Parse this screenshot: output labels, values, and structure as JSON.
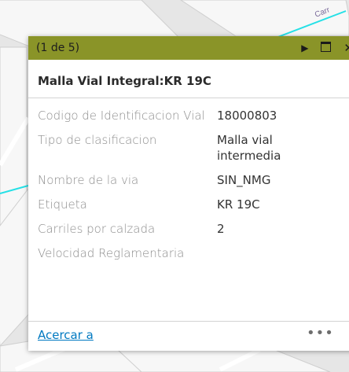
{
  "map": {
    "street_label": "Carr",
    "colors": {
      "background": "#e8e8e8",
      "block": "#f6f6f6",
      "road_highlight": "#25e0e6"
    }
  },
  "popup": {
    "header": {
      "counter": "(1 de 5)",
      "next_icon": "triangle-right-icon",
      "maximize_icon": "maximize-icon",
      "close_icon": "close-icon",
      "color": "#8a9428"
    },
    "title": "Malla Vial Integral:KR 19C",
    "attributes": [
      {
        "key": "Codigo de Identificacion Vial",
        "value": "18000803"
      },
      {
        "key": "Tipo de clasificacion",
        "value": "Malla vial intermedia"
      },
      {
        "key": "Nombre de la via",
        "value": "SIN_NMG"
      },
      {
        "key": "Etiqueta",
        "value": "KR 19C"
      },
      {
        "key": "Carriles por calzada",
        "value": "2"
      },
      {
        "key": "Velocidad Reglamentaria",
        "value": ""
      }
    ],
    "footer": {
      "zoom_link": "Acercar a",
      "more_glyph": "•••",
      "link_color": "#0079c1"
    }
  }
}
